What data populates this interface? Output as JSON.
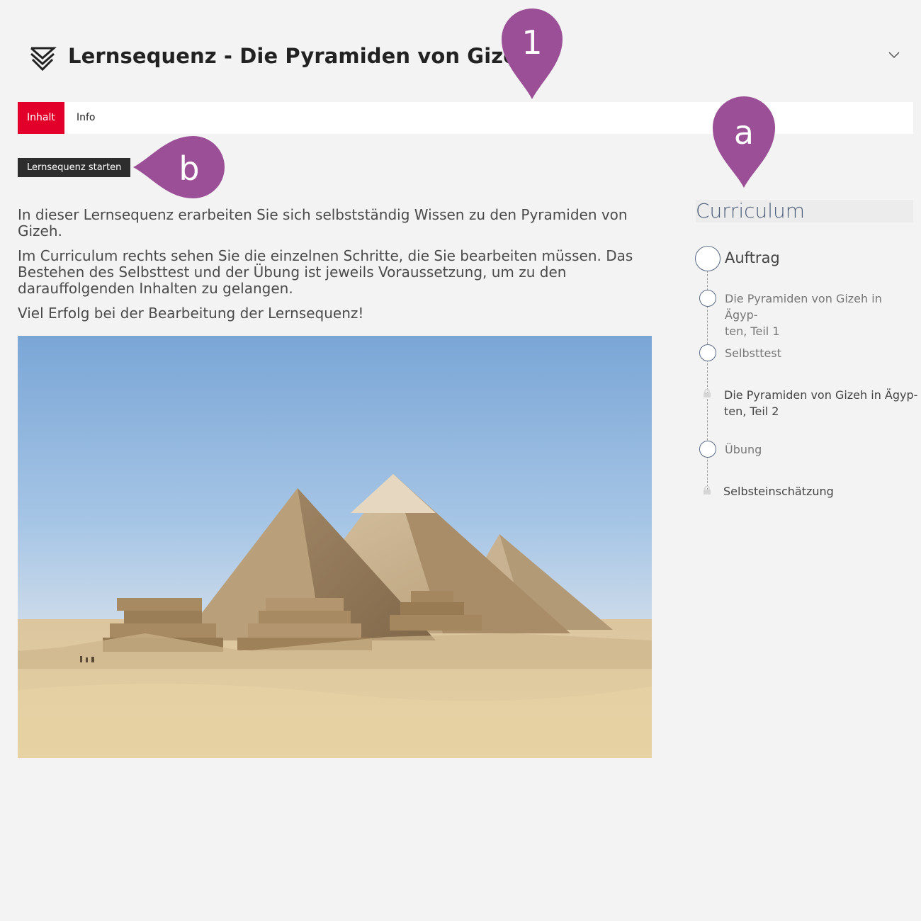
{
  "header": {
    "title": "Lernsequenz - Die Pyramiden von Gizeh",
    "logo_icon": "chevron-down-layered-icon",
    "collapse_icon": "chevron-down-icon"
  },
  "tabs": [
    {
      "label": "Inhalt",
      "active": true
    },
    {
      "label": "Info",
      "active": false
    }
  ],
  "start_button": {
    "label": "Lernsequenz starten"
  },
  "intro": {
    "p1": "In dieser Lernsequenz erarbeiten Sie sich selbstständig Wissen zu den Pyramiden von Gizeh.",
    "p2": "Im Curriculum rechts sehen Sie die einzelnen Schritte, die Sie bearbeiten müssen. Das Bestehen des Selbsttest und der Übung ist jeweils Voraussetzung, um zu den darauffolgenden Inhalten zu gelangen.",
    "p3": "Viel Erfolg bei der Bearbeitung der Lernsequenz!"
  },
  "curriculum": {
    "title": "Curriculum",
    "items": [
      {
        "label": "Auftrag",
        "state": "open"
      },
      {
        "label": "Die Pyramiden von Gizeh in Ägyp-ten, Teil 1",
        "line1": "Die Pyramiden von Gizeh in Ägyp-",
        "line2": "ten, Teil 1",
        "state": "open"
      },
      {
        "label": "Selbsttest",
        "state": "open"
      },
      {
        "label": "Die Pyramiden von Gizeh in Ägyp-ten, Teil 2",
        "line1": "Die Pyramiden von Gizeh in Ägyp-",
        "line2": "ten, Teil 2",
        "state": "locked"
      },
      {
        "label": "Übung",
        "state": "open"
      },
      {
        "label": "Selbsteinschätzung",
        "state": "locked"
      }
    ]
  },
  "annotations": {
    "marker_1": "1",
    "marker_a": "a",
    "marker_b": "b",
    "color": "#9b4f96"
  },
  "colors": {
    "accent_red": "#e2002a",
    "dark_button": "#2d2d2d",
    "curriculum_blue": "#4d5e7a",
    "background": "#f3f3f3"
  }
}
